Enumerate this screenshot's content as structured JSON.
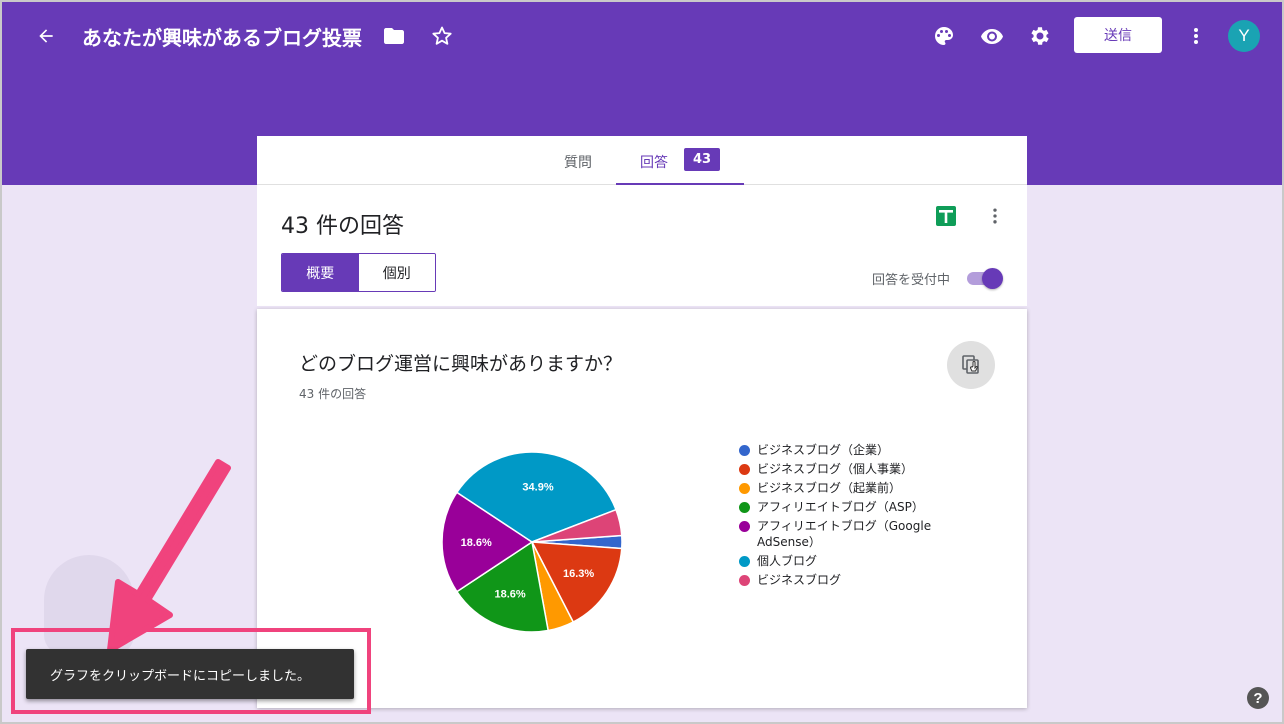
{
  "header": {
    "form_title": "あなたが興味があるブログ投票",
    "send_label": "送信",
    "avatar_initial": "Y",
    "icons": [
      "back-arrow-icon",
      "folder-icon",
      "star-icon",
      "palette-icon",
      "eye-icon",
      "gear-icon",
      "more-vert-icon"
    ]
  },
  "tabs": {
    "questions_label": "質問",
    "responses_label": "回答",
    "responses_count": "43"
  },
  "summary": {
    "title": "43 件の回答",
    "view_summary_label": "概要",
    "view_individual_label": "個別",
    "accepting_label": "回答を受付中",
    "accepting_on": true
  },
  "question": {
    "title": "どのブログ運営に興味がありますか？",
    "response_count": "43 件の回答"
  },
  "chart_data": {
    "type": "pie",
    "categories": [
      "ビジネスブログ（企業）",
      "ビジネスブログ（個人事業）",
      "ビジネスブログ（起業前）",
      "アフィリエイトブログ（ASP）",
      "アフィリエイトブログ（Google AdSense）",
      "個人ブログ",
      "ビジネスブログ"
    ],
    "values": [
      2.3,
      16.3,
      4.7,
      18.6,
      18.6,
      34.9,
      4.7
    ],
    "labels": [
      "",
      "16.3%",
      "",
      "18.6%",
      "18.6%",
      "34.9%",
      ""
    ],
    "colors": [
      "#3366cc",
      "#dc3912",
      "#ff9900",
      "#109618",
      "#990099",
      "#0099c6",
      "#dd4477"
    ]
  },
  "toast": {
    "message": "グラフをクリップボードにコピーしました。"
  },
  "help": {
    "label": "?"
  }
}
